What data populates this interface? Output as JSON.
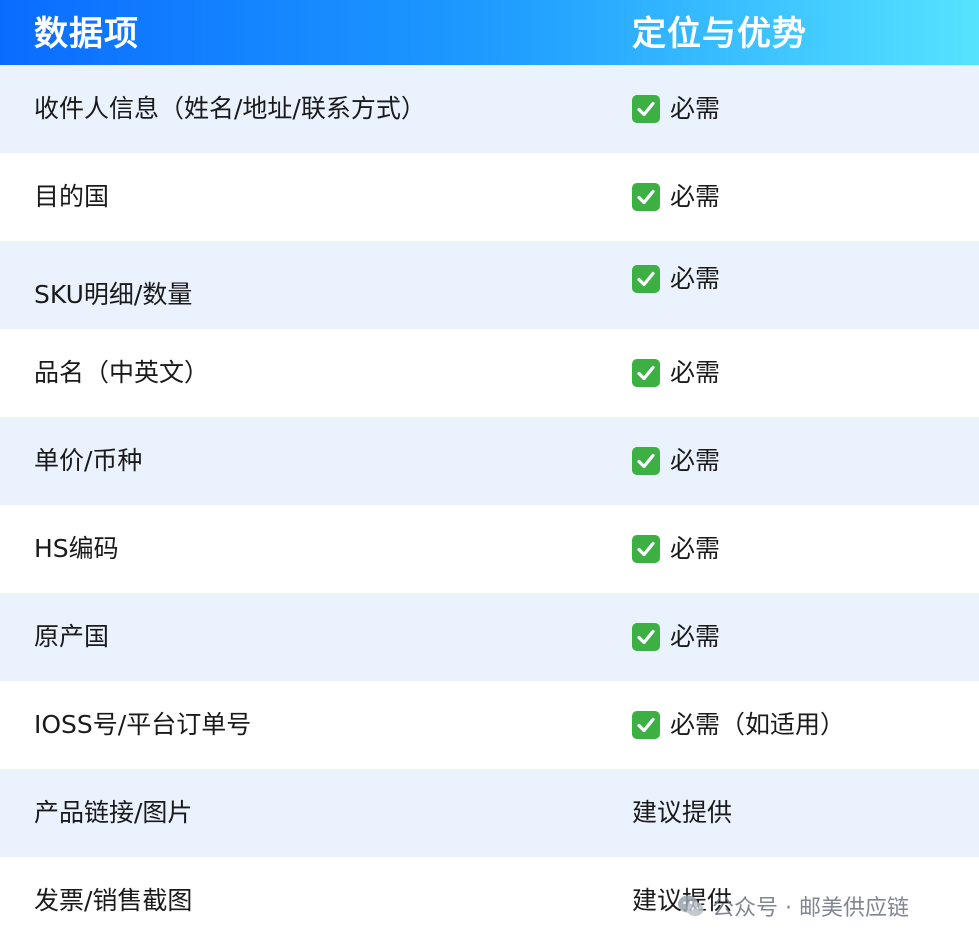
{
  "header": {
    "col1": "数据项",
    "col2": "定位与优势"
  },
  "rows": [
    {
      "item": "收件人信息（姓名/地址/联系方式）",
      "status": "必需",
      "checked": true
    },
    {
      "item": "目的国",
      "status": "必需",
      "checked": true
    },
    {
      "item": "SKU明细/数量",
      "status": "必需",
      "checked": true
    },
    {
      "item": "品名（中英文）",
      "status": "必需",
      "checked": true
    },
    {
      "item": "单价/币种",
      "status": "必需",
      "checked": true
    },
    {
      "item": "HS编码",
      "status": "必需",
      "checked": true
    },
    {
      "item": "原产国",
      "status": "必需",
      "checked": true
    },
    {
      "item": "IOSS号/平台订单号",
      "status": "必需（如适用）",
      "checked": true
    },
    {
      "item": "产品链接/图片",
      "status": "建议提供",
      "checked": false
    },
    {
      "item": "发票/销售截图",
      "status": "建议提供",
      "checked": false
    }
  ],
  "watermark": {
    "text": "公众号 · 邮美供应链",
    "icon": "wechat-icon"
  },
  "colors": {
    "header_gradient_start": "#0a6cff",
    "header_gradient_end": "#55e3ff",
    "row_alt": "#eaf2fe",
    "check_green": "#3cb043"
  }
}
